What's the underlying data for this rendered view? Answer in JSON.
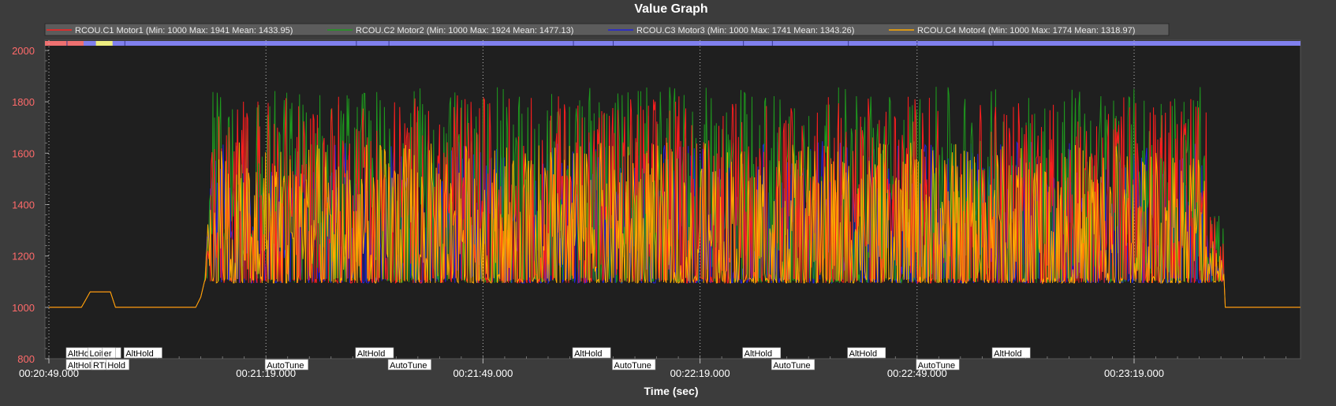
{
  "window": {
    "title": "Value Graph"
  },
  "axes": {
    "xlabel": "Time (sec)",
    "ylabel": "",
    "xticks": [
      "00:20:49.000",
      "00:21:19.000",
      "00:21:49.000",
      "00:22:19.000",
      "00:22:49.000",
      "00:23:19.000"
    ],
    "yticks": [
      "800",
      "1000",
      "1200",
      "1400",
      "1600",
      "1800",
      "2000"
    ]
  },
  "legend": [
    {
      "label": "RCOU.C1 Motor1 (Min: 1000 Max: 1941 Mean: 1433.95)",
      "color": "#ff1e1e"
    },
    {
      "label": "RCOU.C2 Motor2 (Min: 1000 Max: 1924 Mean: 1477.13)",
      "color": "#1e9a1e"
    },
    {
      "label": "RCOU.C3 Motor3 (Min: 1000 Max: 1741 Mean: 1343.26)",
      "color": "#2222dd"
    },
    {
      "label": "RCOU.C4 Motor4 (Min: 1000 Max: 1774 Mean: 1318.97)",
      "color": "#ffaa00"
    }
  ],
  "mode_labels": {
    "row1": [
      {
        "text": "AltHold",
        "t": 2.5
      },
      {
        "text": "Loiter",
        "t": 5.5
      },
      {
        "text": "er",
        "t": 7.5
      },
      {
        "text": "AltHold",
        "t": 10.5
      },
      {
        "text": "AltHold",
        "t": 42.5
      },
      {
        "text": "AltHold",
        "t": 72.5
      },
      {
        "text": "AltHold",
        "t": 96.0
      },
      {
        "text": "AltHold",
        "t": 110.5
      },
      {
        "text": "AltHold",
        "t": 130.5
      }
    ],
    "row2": [
      {
        "text": "AltHold",
        "t": 2.5
      },
      {
        "text": "RTL",
        "t": 6.0
      },
      {
        "text": "Hold",
        "t": 8.0
      },
      {
        "text": "AutoTune",
        "t": 30.0
      },
      {
        "text": "AutoTune",
        "t": 47.0
      },
      {
        "text": "AutoTune",
        "t": 78.0
      },
      {
        "text": "AutoTune",
        "t": 100.0
      },
      {
        "text": "AutoTune",
        "t": 120.0
      }
    ]
  },
  "colors": {
    "background": "#3c3c3c",
    "plot_bg": "#1f1f1f",
    "mode_strip": "#8080ee",
    "mode_strip_start": "#ee7070",
    "mode_strip_loiter": "#eeee80"
  },
  "chart_data": {
    "type": "line",
    "title": "Value Graph",
    "xlabel": "Time (sec)",
    "x_start": "00:20:49.000",
    "xlim_sec": [
      0,
      173
    ],
    "ylim": [
      800,
      2040
    ],
    "grid": false,
    "legend_position": "top",
    "series": [
      {
        "name": "RCOU.C1 Motor1",
        "min": 1000,
        "max": 1941,
        "mean": 1433.95
      },
      {
        "name": "RCOU.C2 Motor2",
        "min": 1000,
        "max": 1924,
        "mean": 1477.13
      },
      {
        "name": "RCOU.C3 Motor3",
        "min": 1000,
        "max": 1741,
        "mean": 1343.26
      },
      {
        "name": "RCOU.C4 Motor4",
        "min": 1000,
        "max": 1774,
        "mean": 1318.97
      }
    ],
    "motor4_profile": [
      {
        "t": 0,
        "v": 1000
      },
      {
        "t": 4.5,
        "v": 1000
      },
      {
        "t": 5.7,
        "v": 1060
      },
      {
        "t": 8.5,
        "v": 1060
      },
      {
        "t": 9.2,
        "v": 1000
      },
      {
        "t": 20.3,
        "v": 1000
      },
      {
        "t": 21.8,
        "v": 1090
      },
      {
        "t": 162,
        "v": 1120
      },
      {
        "t": 162.5,
        "v": 1000
      },
      {
        "t": 173,
        "v": 1000
      }
    ],
    "active_range_sec": [
      21.5,
      162.3
    ]
  }
}
